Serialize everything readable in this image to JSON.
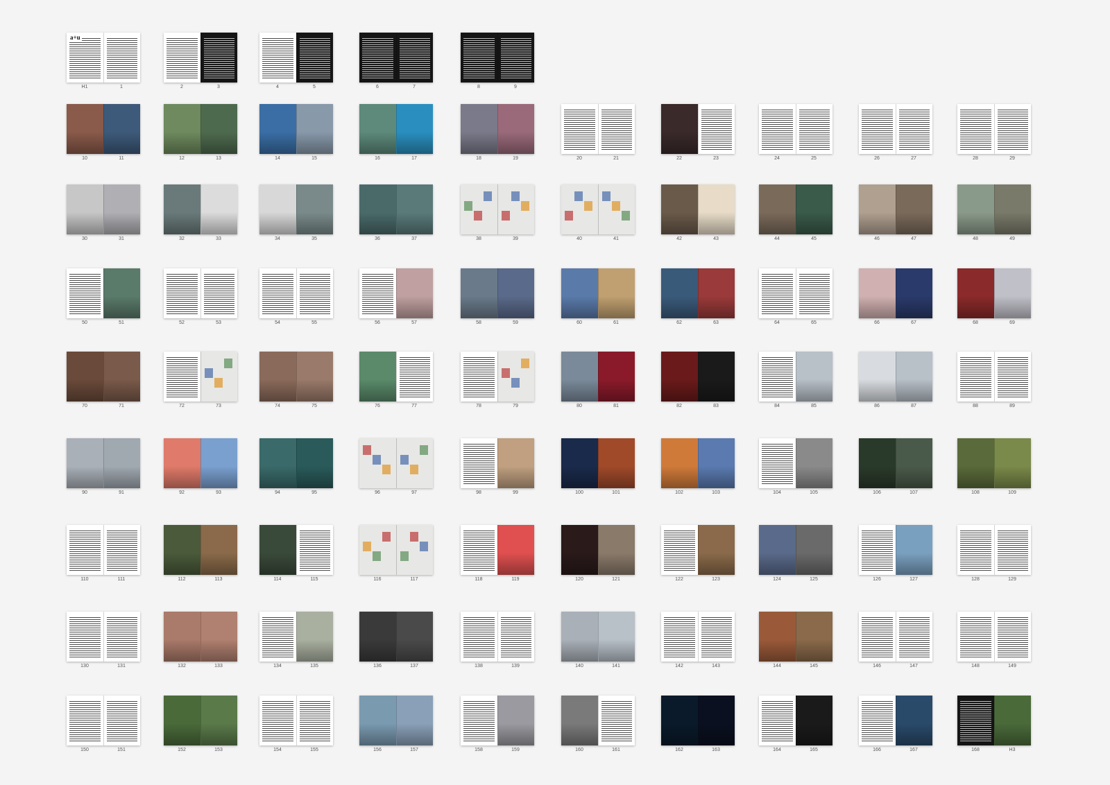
{
  "palette": {
    "paper": "#ffffff",
    "dark": "#151515",
    "pale": "#e7e7e5",
    "page_number": "#555555",
    "background": "#f4f4f4"
  },
  "cover_wordmark": "a+u",
  "spreads": [
    {
      "pages": [
        "H1",
        "1"
      ],
      "left": "white",
      "right": "white"
    },
    {
      "pages": [
        "2",
        "3"
      ],
      "left": "white",
      "right": "dark"
    },
    {
      "pages": [
        "4",
        "5"
      ],
      "left": "white",
      "right": "dark"
    },
    {
      "pages": [
        "6",
        "7"
      ],
      "left": "dark",
      "right": "dark"
    },
    {
      "pages": [
        "8",
        "9"
      ],
      "left": "dark",
      "right": "dark"
    },
    {
      "pages": [
        "10",
        "11"
      ],
      "left": "photo",
      "right": "photo",
      "colors": [
        "#8a5a4a",
        "#3d5a7a"
      ]
    },
    {
      "pages": [
        "12",
        "13"
      ],
      "left": "photo",
      "right": "photo",
      "colors": [
        "#6e8a5e",
        "#4e6a4e"
      ]
    },
    {
      "pages": [
        "14",
        "15"
      ],
      "left": "photo",
      "right": "photo",
      "colors": [
        "#3a6ea5",
        "#8899aa"
      ]
    },
    {
      "pages": [
        "16",
        "17"
      ],
      "left": "photo",
      "right": "photo",
      "colors": [
        "#5d8a7a",
        "#2a8fbf"
      ]
    },
    {
      "pages": [
        "18",
        "19"
      ],
      "left": "photo",
      "right": "photo",
      "colors": [
        "#7a7a8a",
        "#9a6a7a"
      ]
    },
    {
      "pages": [
        "20",
        "21"
      ],
      "left": "white",
      "right": "white"
    },
    {
      "pages": [
        "22",
        "23"
      ],
      "left": "photo",
      "right": "white",
      "colors": [
        "#3a2a2a",
        "#ffffff"
      ]
    },
    {
      "pages": [
        "24",
        "25"
      ],
      "left": "white",
      "right": "white"
    },
    {
      "pages": [
        "26",
        "27"
      ],
      "left": "white",
      "right": "white"
    },
    {
      "pages": [
        "28",
        "29"
      ],
      "left": "white",
      "right": "white"
    },
    {
      "pages": [
        "30",
        "31"
      ],
      "left": "photo",
      "right": "photo",
      "colors": [
        "#c7c7c7",
        "#b0b0b4"
      ]
    },
    {
      "pages": [
        "32",
        "33"
      ],
      "left": "photo",
      "right": "photo",
      "colors": [
        "#6a7a7a",
        "#dcdcdc"
      ]
    },
    {
      "pages": [
        "34",
        "35"
      ],
      "left": "photo",
      "right": "photo",
      "colors": [
        "#d8d8d8",
        "#7a8a8a"
      ]
    },
    {
      "pages": [
        "36",
        "37"
      ],
      "left": "photo",
      "right": "photo",
      "colors": [
        "#4a6a6a",
        "#5a7a7a"
      ]
    },
    {
      "pages": [
        "38",
        "39"
      ],
      "left": "pale",
      "right": "pale"
    },
    {
      "pages": [
        "40",
        "41"
      ],
      "left": "pale",
      "right": "pale"
    },
    {
      "pages": [
        "42",
        "43"
      ],
      "left": "photo",
      "right": "photo",
      "colors": [
        "#6a5a4a",
        "#e8dcc8"
      ]
    },
    {
      "pages": [
        "44",
        "45"
      ],
      "left": "photo",
      "right": "photo",
      "colors": [
        "#7a6a5a",
        "#3a5a4a"
      ]
    },
    {
      "pages": [
        "46",
        "47"
      ],
      "left": "photo",
      "right": "photo",
      "colors": [
        "#b0a090",
        "#7a6a5a"
      ]
    },
    {
      "pages": [
        "48",
        "49"
      ],
      "left": "photo",
      "right": "photo",
      "colors": [
        "#8a9a8a",
        "#7a7a6a"
      ]
    },
    {
      "pages": [
        "50",
        "51"
      ],
      "left": "white",
      "right": "photo",
      "colors": [
        "#ffffff",
        "#5a7a6a"
      ]
    },
    {
      "pages": [
        "52",
        "53"
      ],
      "left": "white",
      "right": "white"
    },
    {
      "pages": [
        "54",
        "55"
      ],
      "left": "white",
      "right": "white"
    },
    {
      "pages": [
        "56",
        "57"
      ],
      "left": "white",
      "right": "photo",
      "colors": [
        "#ffffff",
        "#c0a0a0"
      ]
    },
    {
      "pages": [
        "58",
        "59"
      ],
      "left": "photo",
      "right": "photo",
      "colors": [
        "#6a7a8a",
        "#5a6a8a"
      ]
    },
    {
      "pages": [
        "60",
        "61"
      ],
      "left": "photo",
      "right": "photo",
      "colors": [
        "#5a7aaa",
        "#c0a070"
      ]
    },
    {
      "pages": [
        "62",
        "63"
      ],
      "left": "photo",
      "right": "photo",
      "colors": [
        "#3a5a7a",
        "#9a3a3a"
      ]
    },
    {
      "pages": [
        "64",
        "65"
      ],
      "left": "white",
      "right": "white"
    },
    {
      "pages": [
        "66",
        "67"
      ],
      "left": "photo",
      "right": "photo",
      "colors": [
        "#d0b0b0",
        "#2a3a6a"
      ]
    },
    {
      "pages": [
        "68",
        "69"
      ],
      "left": "photo",
      "right": "photo",
      "colors": [
        "#8a2a2a",
        "#c0c0c8"
      ]
    },
    {
      "pages": [
        "70",
        "71"
      ],
      "left": "photo",
      "right": "photo",
      "colors": [
        "#6a4a3a",
        "#7a5a4a"
      ]
    },
    {
      "pages": [
        "72",
        "73"
      ],
      "left": "white",
      "right": "pale"
    },
    {
      "pages": [
        "74",
        "75"
      ],
      "left": "photo",
      "right": "photo",
      "colors": [
        "#8a6a5a",
        "#9a7a6a"
      ]
    },
    {
      "pages": [
        "76",
        "77"
      ],
      "left": "photo",
      "right": "white",
      "colors": [
        "#5a8a6a",
        "#ffffff"
      ]
    },
    {
      "pages": [
        "78",
        "79"
      ],
      "left": "white",
      "right": "pale"
    },
    {
      "pages": [
        "80",
        "81"
      ],
      "left": "photo",
      "right": "photo",
      "colors": [
        "#7a8a9a",
        "#8a1a2a"
      ]
    },
    {
      "pages": [
        "82",
        "83"
      ],
      "left": "photo",
      "right": "photo",
      "colors": [
        "#6a1a1a",
        "#1a1a1a"
      ]
    },
    {
      "pages": [
        "84",
        "85"
      ],
      "left": "white",
      "right": "photo",
      "colors": [
        "#ffffff",
        "#b8c0c8"
      ]
    },
    {
      "pages": [
        "86",
        "87"
      ],
      "left": "photo",
      "right": "photo",
      "colors": [
        "#d8dce0",
        "#b8c0c8"
      ]
    },
    {
      "pages": [
        "88",
        "89"
      ],
      "left": "white",
      "right": "white"
    },
    {
      "pages": [
        "90",
        "91"
      ],
      "left": "photo",
      "right": "photo",
      "colors": [
        "#aab0b8",
        "#a0a8b0"
      ]
    },
    {
      "pages": [
        "92",
        "93"
      ],
      "left": "photo",
      "right": "photo",
      "colors": [
        "#e07a6a",
        "#7aa0d0"
      ]
    },
    {
      "pages": [
        "94",
        "95"
      ],
      "left": "photo",
      "right": "photo",
      "colors": [
        "#3a6a6a",
        "#2a5a5a"
      ]
    },
    {
      "pages": [
        "96",
        "97"
      ],
      "left": "pale",
      "right": "pale"
    },
    {
      "pages": [
        "98",
        "99"
      ],
      "left": "white",
      "right": "photo",
      "colors": [
        "#ffffff",
        "#c0a080"
      ]
    },
    {
      "pages": [
        "100",
        "101"
      ],
      "left": "photo",
      "right": "photo",
      "colors": [
        "#1a2a4a",
        "#a04a2a"
      ]
    },
    {
      "pages": [
        "102",
        "103"
      ],
      "left": "photo",
      "right": "photo",
      "colors": [
        "#d07a3a",
        "#5a7ab0"
      ]
    },
    {
      "pages": [
        "104",
        "105"
      ],
      "left": "white",
      "right": "photo",
      "colors": [
        "#ffffff",
        "#8a8a8a"
      ]
    },
    {
      "pages": [
        "106",
        "107"
      ],
      "left": "photo",
      "right": "photo",
      "colors": [
        "#2a3a2a",
        "#4a5a4a"
      ]
    },
    {
      "pages": [
        "108",
        "109"
      ],
      "left": "photo",
      "right": "photo",
      "colors": [
        "#5a6a3a",
        "#7a8a4a"
      ]
    },
    {
      "pages": [
        "110",
        "111"
      ],
      "left": "white",
      "right": "white"
    },
    {
      "pages": [
        "112",
        "113"
      ],
      "left": "photo",
      "right": "photo",
      "colors": [
        "#4a5a3a",
        "#8a6a4a"
      ]
    },
    {
      "pages": [
        "114",
        "115"
      ],
      "left": "photo",
      "right": "white",
      "colors": [
        "#3a4a3a",
        "#ffffff"
      ]
    },
    {
      "pages": [
        "116",
        "117"
      ],
      "left": "pale",
      "right": "pale"
    },
    {
      "pages": [
        "118",
        "119"
      ],
      "left": "white",
      "right": "photo",
      "colors": [
        "#ffffff",
        "#e05050"
      ]
    },
    {
      "pages": [
        "120",
        "121"
      ],
      "left": "photo",
      "right": "photo",
      "colors": [
        "#2a1a1a",
        "#8a7a6a"
      ]
    },
    {
      "pages": [
        "122",
        "123"
      ],
      "left": "white",
      "right": "photo",
      "colors": [
        "#ffffff",
        "#8a6a4a"
      ]
    },
    {
      "pages": [
        "124",
        "125"
      ],
      "left": "photo",
      "right": "photo",
      "colors": [
        "#5a6a8a",
        "#6a6a6a"
      ]
    },
    {
      "pages": [
        "126",
        "127"
      ],
      "left": "white",
      "right": "photo",
      "colors": [
        "#ffffff",
        "#7aa0c0"
      ]
    },
    {
      "pages": [
        "128",
        "129"
      ],
      "left": "white",
      "right": "white"
    },
    {
      "pages": [
        "130",
        "131"
      ],
      "left": "white",
      "right": "white"
    },
    {
      "pages": [
        "132",
        "133"
      ],
      "left": "photo",
      "right": "photo",
      "colors": [
        "#aa7a6a",
        "#b08070"
      ]
    },
    {
      "pages": [
        "134",
        "135"
      ],
      "left": "white",
      "right": "photo",
      "colors": [
        "#ffffff",
        "#aab0a0"
      ]
    },
    {
      "pages": [
        "136",
        "137"
      ],
      "left": "photo",
      "right": "photo",
      "colors": [
        "#3a3a3a",
        "#4a4a4a"
      ]
    },
    {
      "pages": [
        "138",
        "139"
      ],
      "left": "white",
      "right": "white"
    },
    {
      "pages": [
        "140",
        "141"
      ],
      "left": "photo",
      "right": "photo",
      "colors": [
        "#aab0b8",
        "#b8c0c8"
      ]
    },
    {
      "pages": [
        "142",
        "143"
      ],
      "left": "white",
      "right": "white"
    },
    {
      "pages": [
        "144",
        "145"
      ],
      "left": "photo",
      "right": "photo",
      "colors": [
        "#9a5a3a",
        "#8a6a4a"
      ]
    },
    {
      "pages": [
        "146",
        "147"
      ],
      "left": "white",
      "right": "white"
    },
    {
      "pages": [
        "148",
        "149"
      ],
      "left": "white",
      "right": "white"
    },
    {
      "pages": [
        "150",
        "151"
      ],
      "left": "white",
      "right": "white"
    },
    {
      "pages": [
        "152",
        "153"
      ],
      "left": "photo",
      "right": "photo",
      "colors": [
        "#4a6a3a",
        "#5a7a4a"
      ]
    },
    {
      "pages": [
        "154",
        "155"
      ],
      "left": "white",
      "right": "white"
    },
    {
      "pages": [
        "156",
        "157"
      ],
      "left": "photo",
      "right": "photo",
      "colors": [
        "#7a9ab0",
        "#8aa0b8"
      ]
    },
    {
      "pages": [
        "158",
        "159"
      ],
      "left": "white",
      "right": "photo",
      "colors": [
        "#ffffff",
        "#9a9aa0"
      ]
    },
    {
      "pages": [
        "160",
        "161"
      ],
      "left": "photo",
      "right": "white",
      "colors": [
        "#7a7a7a",
        "#ffffff"
      ]
    },
    {
      "pages": [
        "162",
        "163"
      ],
      "left": "photo",
      "right": "photo",
      "colors": [
        "#0a1a2a",
        "#0a1020"
      ]
    },
    {
      "pages": [
        "164",
        "165"
      ],
      "left": "white",
      "right": "photo",
      "colors": [
        "#ffffff",
        "#1a1a1a"
      ]
    },
    {
      "pages": [
        "166",
        "167"
      ],
      "left": "white",
      "right": "photo",
      "colors": [
        "#ffffff",
        "#2a4a6a"
      ]
    },
    {
      "pages": [
        "168",
        "H3"
      ],
      "left": "dark",
      "right": "photo",
      "colors": [
        "#151515",
        "#4a6a3a"
      ]
    }
  ]
}
